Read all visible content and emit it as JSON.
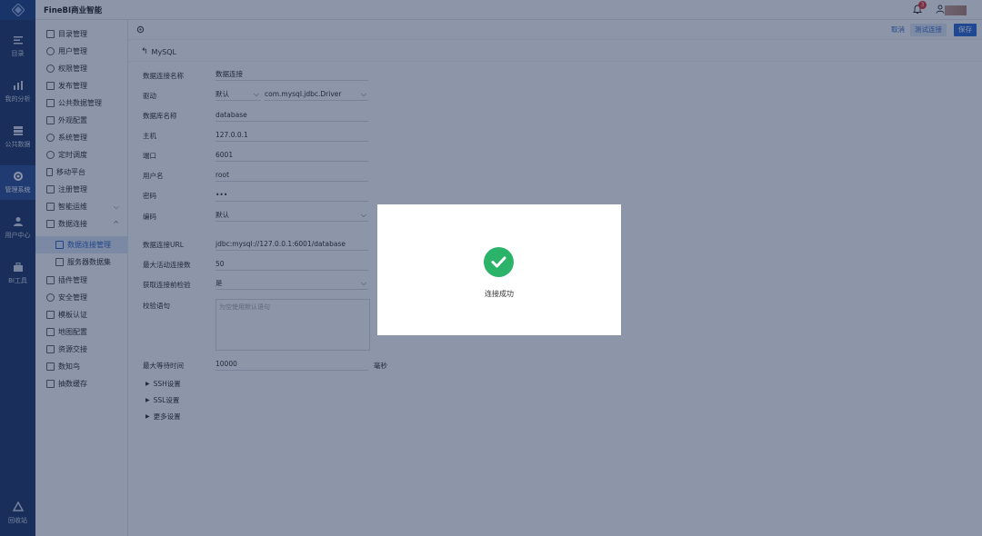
{
  "app": {
    "title": "FineBI商业智能"
  },
  "header": {
    "notification_count": "3"
  },
  "nav": {
    "items": [
      {
        "label": "目录",
        "icon": "catalog-icon"
      },
      {
        "label": "我的分析",
        "icon": "analysis-icon"
      },
      {
        "label": "公共数据",
        "icon": "public-data-icon"
      },
      {
        "label": "管理系统",
        "icon": "manage-system-icon"
      },
      {
        "label": "用户中心",
        "icon": "user-center-icon"
      },
      {
        "label": "BI工具",
        "icon": "toolbox-icon"
      },
      {
        "label": "回收站",
        "icon": "recycle-bin-icon"
      }
    ]
  },
  "menu": {
    "items": [
      {
        "label": "目录管理"
      },
      {
        "label": "用户管理"
      },
      {
        "label": "权限管理"
      },
      {
        "label": "发布管理"
      },
      {
        "label": "公共数据管理"
      },
      {
        "label": "外观配置"
      },
      {
        "label": "系统管理"
      },
      {
        "label": "定时调度"
      },
      {
        "label": "移动平台"
      },
      {
        "label": "注册管理"
      },
      {
        "label": "智能运维"
      },
      {
        "label": "数据连接"
      },
      {
        "label": "数据连接管理"
      },
      {
        "label": "服务器数据集"
      },
      {
        "label": "插件管理"
      },
      {
        "label": "安全管理"
      },
      {
        "label": "模板认证"
      },
      {
        "label": "地图配置"
      },
      {
        "label": "资源交接"
      },
      {
        "label": "数知鸟"
      },
      {
        "label": "抽数缓存"
      }
    ]
  },
  "toolbar": {
    "cancel_label": "取消",
    "test_label": "测试连接",
    "save_label": "保存"
  },
  "form": {
    "back_label": "MySQL",
    "name_label": "数据连接名称",
    "name_value": "数据连接",
    "driver_label": "驱动",
    "driver_mode": "默认",
    "driver_class": "com.mysql.jdbc.Driver",
    "db_label": "数据库名称",
    "db_value": "database",
    "host_label": "主机",
    "host_value": "127.0.0.1",
    "port_label": "端口",
    "port_value": "6001",
    "user_label": "用户名",
    "user_value": "root",
    "pwd_label": "密码",
    "pwd_value": "•••",
    "enc_label": "编码",
    "enc_value": "默认",
    "url_label": "数据连接URL",
    "url_value": "jdbc:mysql://127.0.0.1:6001/database",
    "maxconn_label": "最大活动连接数",
    "maxconn_value": "50",
    "check_label": "获取连接前检验",
    "check_value": "是",
    "sql_label": "校验语句",
    "sql_placeholder": "为空使用默认语句",
    "wait_label": "最大等待时间",
    "wait_value": "10000",
    "wait_unit": "毫秒",
    "ssh_label": "SSH设置",
    "ssl_label": "SSL设置",
    "more_label": "更多设置"
  },
  "dialog": {
    "message": "连接成功"
  }
}
